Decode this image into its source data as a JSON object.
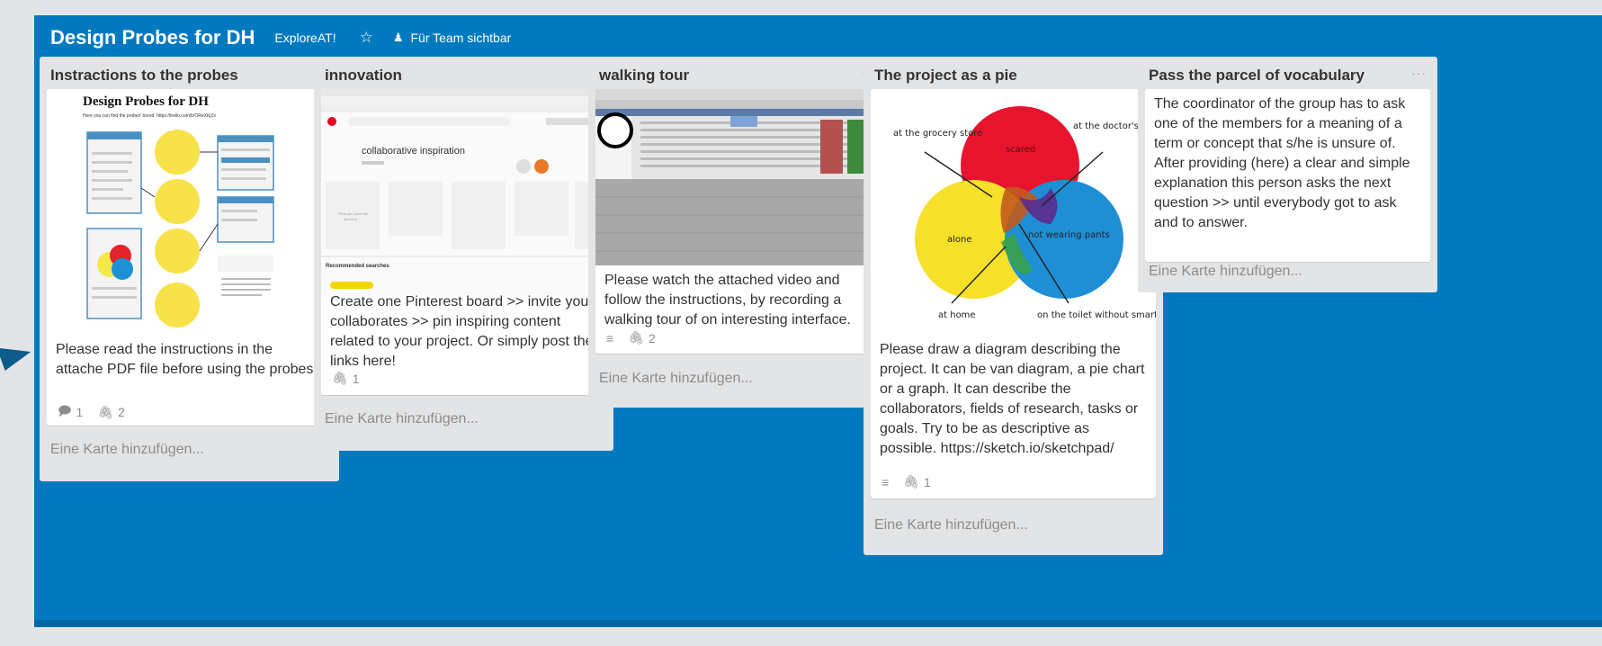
{
  "header": {
    "board_title": "Design Probes for DH",
    "org": "ExploreAT!",
    "visibility": "Für Team sichtbar"
  },
  "lists": [
    {
      "title": "Instractions to the probes",
      "menu": "···",
      "cover": {
        "doc_title": "Design Probes for DH",
        "doc_subtitle": "Here you can find the probes' bored: https://trello.com/b/OReXKjZx",
        "bubbles": [
          "copy the board in order to set a privat board for your team",
          "Change setting of the new board to 'team' or 'privat'",
          "Add your team members and set a deadline",
          "The team members contribute to each column in a separate card"
        ]
      },
      "card_text": "Please read the instructions in the attache PDF file before using the probes",
      "comments": "1",
      "attachments": "2",
      "add_card": "Eine Karte hinzufügen..."
    },
    {
      "title": "innovation",
      "menu": "···",
      "cover": {
        "board_name": "collaborative inspiration",
        "section": "Recommended searches"
      },
      "card_text": "Create one Pinterest board >> invite your collaborates >> pin inspiring content related to your project. Or simply post the links here!",
      "attachments": "1",
      "add_card": "Eine Karte hinzufügen..."
    },
    {
      "title": "walking tour",
      "menu": "···",
      "card_text": "Please watch the attached video and follow the instructions, by recording a walking tour of on interesting interface.",
      "attachments": "2",
      "add_card": "Eine Karte hinzufügen..."
    },
    {
      "title": "The project as a pie",
      "menu": "···",
      "cover": {
        "labels": [
          "at the grocery store",
          "at the doctor's office",
          "scared",
          "alone",
          "not wearing pants",
          "at home",
          "on the toilet without smartphone"
        ]
      },
      "card_text": "Please draw a diagram describing the project. It can be van diagram, a pie chart or a graph. It can describe the collaborators, fields of research, tasks or goals. Try to be as descriptive as possible. https://sketch.io/sketchpad/",
      "attachments": "1",
      "add_card": "Eine Karte hinzufügen..."
    },
    {
      "title": "Pass the parcel of vocabulary",
      "menu": "···",
      "card_text": "The coordinator of the group has to ask one of the members for a meaning of a term or concept that s/he is unsure of. After providing (here) a clear and simple explanation this person asks the next question >> until everybody got to ask and to answer.",
      "add_card": "Eine Karte hinzufügen..."
    }
  ],
  "colors": {
    "board_bg": "#0079bf",
    "list_bg": "#e2e4e6",
    "card_bg": "#ffffff",
    "label_yellow": "#f2d600"
  }
}
